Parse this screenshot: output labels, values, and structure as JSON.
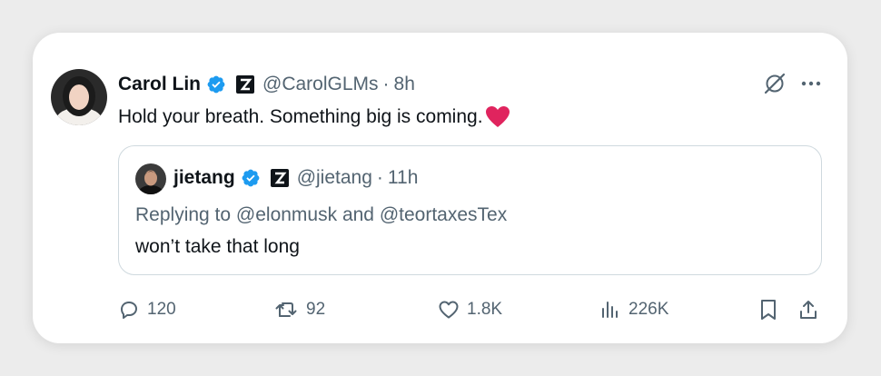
{
  "tweet": {
    "author_name": "Carol Lin",
    "author_handle": "@CarolGLMs",
    "separator": "·",
    "time": "8h",
    "text": "Hold your breath. Something big is coming.",
    "text_emoji": "heart-emoji"
  },
  "quote": {
    "author_name": "jietang",
    "author_handle": "@jietang",
    "separator": "·",
    "time": "11h",
    "replying_prefix": "Replying to",
    "replying_mention_1": "@elonmusk",
    "replying_and": "and",
    "replying_mention_2": "@teortaxesTex",
    "text": "won’t take that long"
  },
  "actions": {
    "replies": "120",
    "retweets": "92",
    "likes": "1.8K",
    "views": "226K"
  },
  "colors": {
    "verified_blue": "#1d9bf0",
    "secondary_text": "#536471",
    "heart_red": "#e0245e",
    "border": "#cfd9de"
  },
  "icons": [
    "verified-badge-icon",
    "z-logo-icon",
    "grok-icon",
    "more-options-icon",
    "reply-icon",
    "retweet-icon",
    "like-icon",
    "views-icon",
    "bookmark-icon",
    "share-icon"
  ]
}
